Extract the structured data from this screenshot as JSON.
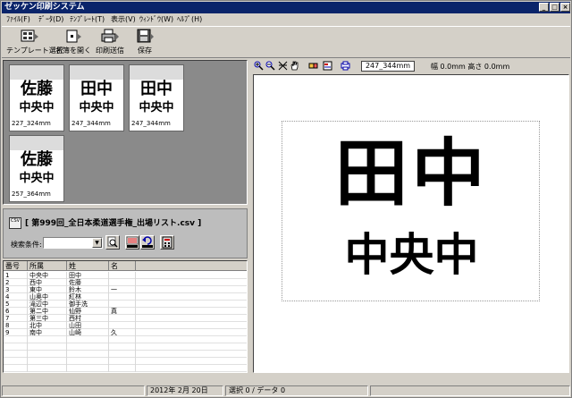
{
  "window": {
    "title": "ゼッケン印刷システム"
  },
  "menu": [
    "ﾌｧｲﾙ(F)",
    "ﾃﾞｰﾀ(D)",
    "ﾃﾝﾌﾟﾚｰﾄ(T)",
    "表示(V)",
    "ｳｨﾝﾄﾞｳ(W)",
    "ﾍﾙﾌﾟ(H)"
  ],
  "toolbar": {
    "template_select": "テンプレート選択",
    "open_list": "名簿を開く",
    "print_send": "印刷送信",
    "save": "保存"
  },
  "thumbnails": [
    {
      "name": "佐藤",
      "school": "中央中",
      "size": "227_324mm"
    },
    {
      "name": "田中",
      "school": "中央中",
      "size": "247_344mm"
    },
    {
      "name": "田中",
      "school": "中央中",
      "size": "247_344mm"
    },
    {
      "name": "佐藤",
      "school": "中央中",
      "size": "257_364mm"
    }
  ],
  "list": {
    "csv_icon_text": "CSV",
    "filename": "[ 第999回_全日本柔道選手権_出場リスト.csv ]",
    "search_label": "検索条件:",
    "search_value": ""
  },
  "table": {
    "columns": [
      "番号",
      "所属",
      "姓",
      "名"
    ],
    "rows": [
      [
        "1",
        "中央中",
        "田中",
        ""
      ],
      [
        "2",
        "西中",
        "佐藤",
        ""
      ],
      [
        "3",
        "東中",
        "鈴木",
        "一"
      ],
      [
        "4",
        "山奥中",
        "紅林",
        ""
      ],
      [
        "5",
        "滝辺中",
        "御手洗",
        ""
      ],
      [
        "6",
        "第二中",
        "仙野",
        "真"
      ],
      [
        "7",
        "第三中",
        "西村",
        ""
      ],
      [
        "8",
        "北中",
        "山田",
        ""
      ],
      [
        "9",
        "南中",
        "山崎",
        "久"
      ]
    ]
  },
  "preview": {
    "size_display": "247_344mm",
    "dims_text": "幅 0.0mm 高さ 0.0mm",
    "name": "田中",
    "school": "中央中"
  },
  "status": {
    "date": "2012年 2月 20日",
    "selection": "選択 0 / データ 0"
  },
  "colors": {
    "titlebar": "#0a246a",
    "face": "#d4d0c8",
    "thumb_bg": "#8a8a8a"
  }
}
